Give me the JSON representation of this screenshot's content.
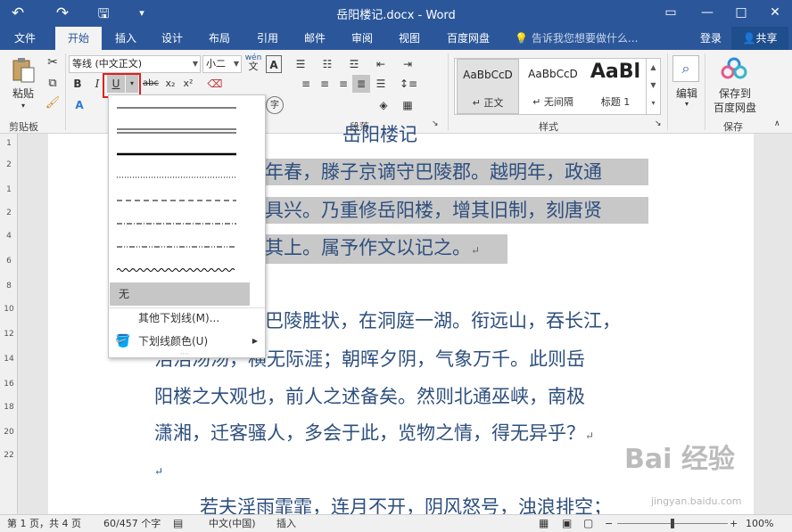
{
  "titlebar": {
    "title": "岳阳楼记.docx - Word",
    "undo_icon": "↶",
    "redo_icon": "↷",
    "save_icon": "🖫",
    "customize_icon": "▾",
    "restore_icon": "▭",
    "minimize_icon": "—",
    "maximize_icon": "□",
    "close_icon": "✕"
  },
  "tabs": {
    "items": [
      "文件",
      "开始",
      "插入",
      "设计",
      "布局",
      "引用",
      "邮件",
      "审阅",
      "视图",
      "百度网盘"
    ],
    "active": "开始",
    "tell_me": "告诉我您想要做什么...",
    "login": "登录",
    "share": "共享"
  },
  "ribbon": {
    "clipboard": {
      "paste_label": "粘贴",
      "group_label": "剪贴板"
    },
    "font": {
      "font_name": "等线 (中文正文)",
      "font_size": "小二",
      "bold": "B",
      "italic": "I",
      "underline": "U",
      "strike": "abc",
      "subscript": "x₂",
      "superscript": "x²",
      "wen": "wén",
      "wen_char": "文",
      "box_a": "A"
    },
    "paragraph": {
      "group_label": "段落"
    },
    "styles": {
      "items": [
        {
          "sample": "AaBbCcD",
          "name": "↵ 正文"
        },
        {
          "sample": "AaBbCcD",
          "name": "↵ 无间隔"
        },
        {
          "sample": "AaBl",
          "name": "标题 1"
        }
      ],
      "group_label": "样式"
    },
    "editing": {
      "label": "编辑"
    },
    "save": {
      "label1": "保存到",
      "label2": "百度网盘",
      "group_label": "保存"
    }
  },
  "ruler": [
    "1",
    "2",
    "1",
    "2",
    "4",
    "6",
    "8",
    "10",
    "12",
    "14",
    "16",
    "18",
    "20",
    "22"
  ],
  "document": {
    "heading_fragment": "岳阳楼记",
    "lines": [
      "年春，滕子京谪守巴陵郡。越明年，政通",
      "具兴。乃重修岳阳楼，增其旧制，刻唐贤",
      "其上。属予作文以记之。",
      "巴陵胜状，在洞庭一湖。衔远山，吞长江，",
      "浩浩汤汤，横无际涯；朝晖夕阴，气象万千。此则岳",
      "阳楼之大观也，前人之述备矣。然则北通巫峡，南极",
      "潇湘，迁客骚人，多会于此，览物之情，得无异乎？",
      "若夫淫雨霏霏，连月不开，阴风怒号，浊浪排空；"
    ],
    "para_mark": "↵"
  },
  "underline_menu": {
    "none_label": "无",
    "more_label": "其他下划线(M)...",
    "color_label": "下划线颜色(U)"
  },
  "status": {
    "page": "第 1 页，共 4 页",
    "words": "60/457 个字",
    "language": "中文(中国)",
    "mode": "插入",
    "zoom": "100%",
    "zoom_level": 100
  },
  "watermark": {
    "text": "Bai 经验",
    "url": "jingyan.baidu.com"
  },
  "colors": {
    "accent": "#2b579a",
    "highlight": "#c8c8c8",
    "text": "#2e4f7e",
    "annotation": "#e02020"
  }
}
